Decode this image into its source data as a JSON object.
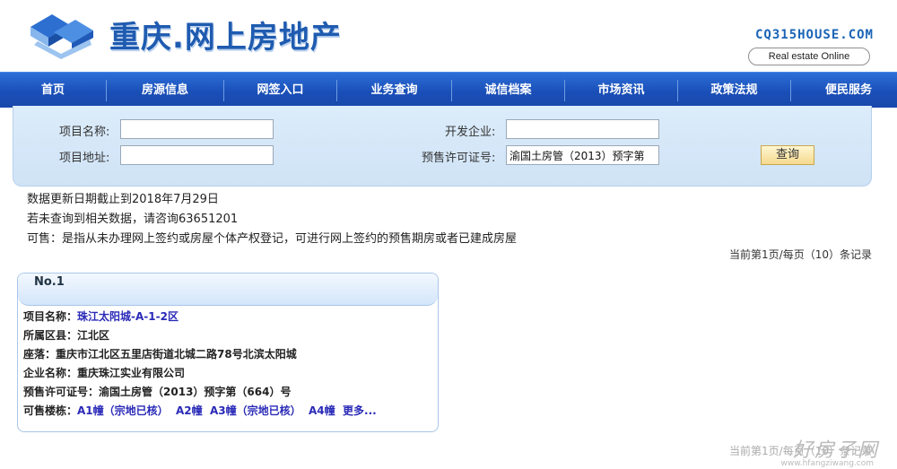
{
  "header": {
    "title": "重庆.网上房地产",
    "brand_en": "CQ315HOUSE.COM",
    "tagline": "Real estate Online"
  },
  "nav": {
    "items": [
      "首页",
      "房源信息",
      "网签入口",
      "业务查询",
      "诚信档案",
      "市场资讯",
      "政策法规",
      "便民服务"
    ]
  },
  "search": {
    "project_name_label": "项目名称:",
    "project_name_value": "",
    "developer_label": "开发企业:",
    "developer_value": "",
    "project_address_label": "项目地址:",
    "project_address_value": "",
    "presale_label": "预售许可证号:",
    "presale_value": "渝国土房管（2013）预字第",
    "query_button": "查询"
  },
  "info": {
    "update_line": "数据更新日期截止到2018年7月29日",
    "contact_line": "若未查询到相关数据，请咨询63651201",
    "definition_line": "可售：是指从未办理网上签约或房屋个体产权登记，可进行网上签约的预售期房或者已建成房屋",
    "page_info": "当前第1页/每页（10）条记录"
  },
  "result": {
    "number": "No.1",
    "project_name_label": "项目名称：",
    "project_name": "珠江太阳城-A-1-2区",
    "district_label": "所属区县：",
    "district": "江北区",
    "location_label": "座落：",
    "location": "重庆市江北区五里店街道北城二路78号北滨太阳城",
    "company_label": "企业名称：",
    "company": "重庆珠江实业有限公司",
    "presale_label": "预售许可证号：",
    "presale": "渝国土房管（2013）预字第（664）号",
    "buildings_label": "可售楼栋：",
    "buildings": [
      "A1幢（宗地已核）",
      "A2幢",
      "A3幢（宗地已核）",
      "A4幢"
    ],
    "more": "更多..."
  },
  "footer": {
    "page_info": "当前第1页/每页（10）条记录",
    "watermark": "好房子网",
    "watermark_url": "www.hfangziwang.com"
  }
}
